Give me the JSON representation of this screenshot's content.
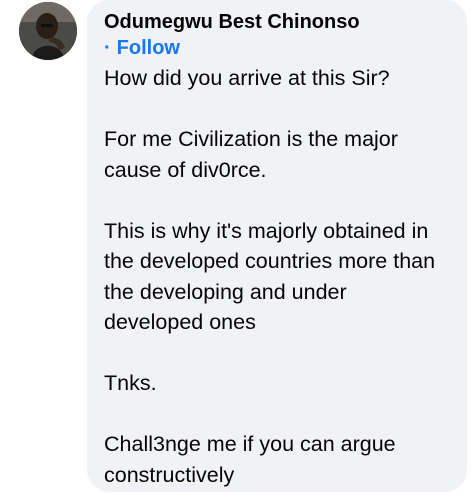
{
  "comment": {
    "author": "Odumegwu Best Chinonso",
    "separator": "·",
    "follow_label": "Follow",
    "paragraphs": [
      "How did you arrive at this Sir?",
      "For me Civilization is the major cause of div0rce.",
      "This is why it's majorly obtained in the developed countries more than the developing and under developed ones",
      "Tnks.",
      "Chall3nge me if you can argue constructively"
    ]
  },
  "colors": {
    "bubble": "#f0f2f5",
    "text": "#050505",
    "link": "#1877f2"
  }
}
